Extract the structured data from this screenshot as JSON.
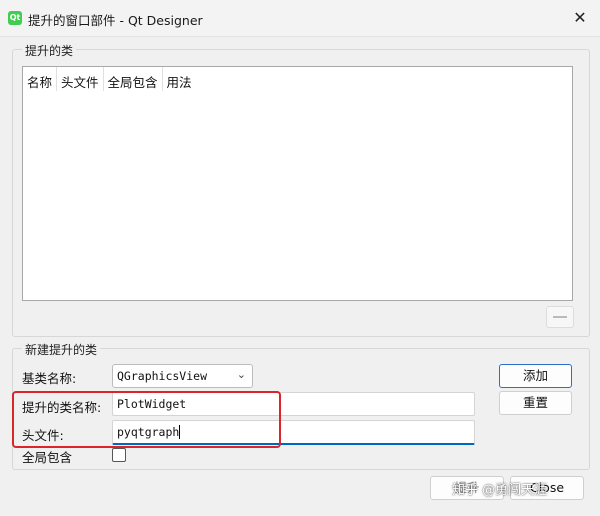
{
  "window": {
    "title": "提升的窗口部件 - Qt Designer",
    "icon": "qt-designer-icon",
    "icon_text": "Qt",
    "close_glyph": "✕"
  },
  "promoted_classes": {
    "group_title": "提升的类",
    "columns": [
      "名称",
      "头文件",
      "全局包含",
      "用法"
    ],
    "rows": []
  },
  "new_promotion": {
    "group_title": "新建提升的类",
    "base_class_label": "基类名称:",
    "base_class_value": "QGraphicsView",
    "class_name_label": "提升的类名称:",
    "class_name_value": "PlotWidget",
    "header_file_label": "头文件:",
    "header_file_value": "pyqtgraph",
    "global_include_label": "全局包含",
    "global_include_checked": false,
    "add_button": "添加",
    "reset_button": "重置"
  },
  "footer": {
    "promote_button": "提升",
    "close_button": "Close"
  },
  "watermark": "知乎 @勇闯天涯",
  "colors": {
    "highlight": "#d9262a",
    "focus_accent": "#0067c0",
    "default_button_border": "#2b6fc6"
  }
}
